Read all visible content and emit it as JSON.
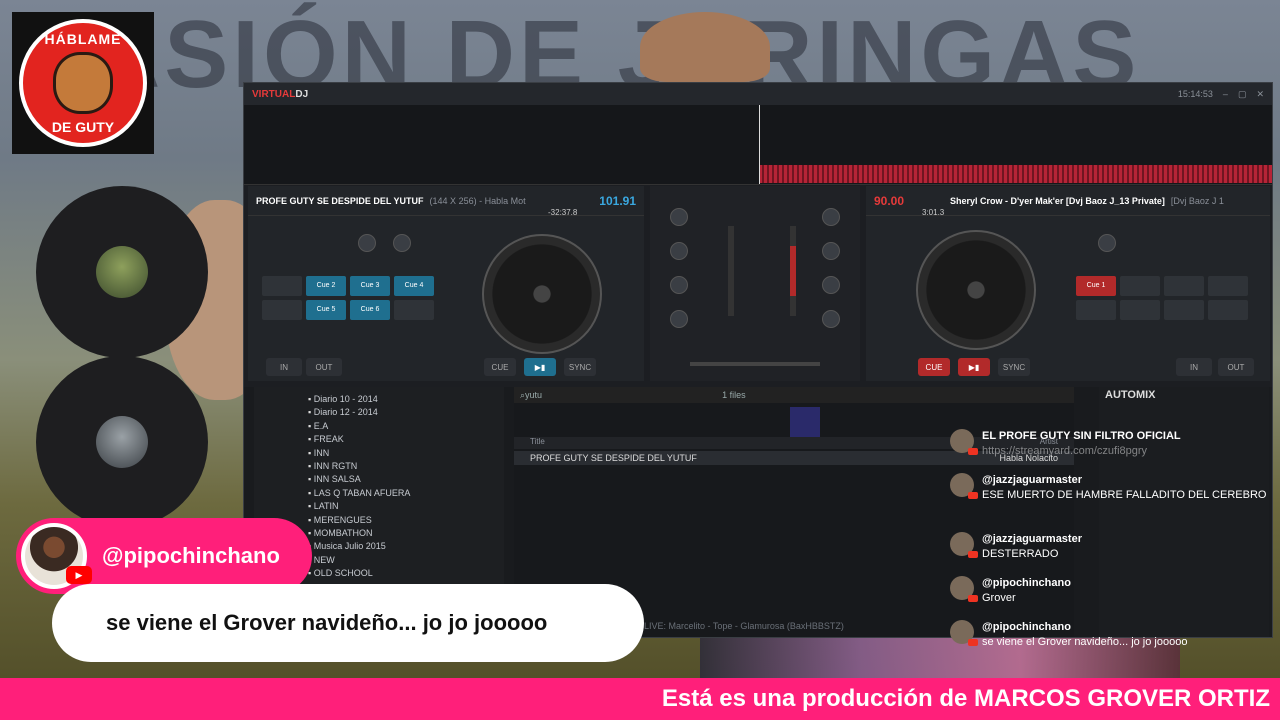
{
  "logo": {
    "top": "HÁBLAME",
    "bottom": "DE GUTY"
  },
  "background": {
    "title_text": "PASIÓN DE JERINGAS"
  },
  "vdj": {
    "app_name_a": "VIRTUAL",
    "app_name_b": "DJ",
    "time": "15:14:53",
    "left_deck": {
      "title": "PROFE GUTY SE DESPIDE DEL YUTUF",
      "meta": "(144 X 256) - Habla Mot",
      "bpm": "101.91",
      "elapsed": "-32:37.8"
    },
    "right_deck": {
      "title": "Sheryl Crow - D'yer Mak'er [Dvj Baoz J_13 Private]",
      "meta": "[Dvj Baoz J 1",
      "bpm": "90.00",
      "elapsed": "3:01.3"
    },
    "left_pads": [
      "Cue 2",
      "Cue 3",
      "Cue 4",
      "Cue 5",
      "Cue 6"
    ],
    "right_pads": [
      "Cue 1"
    ],
    "left_controls": [
      "IN",
      "OUT",
      "CUE",
      "▶▮",
      "SYNC"
    ],
    "right_controls": [
      "CUE",
      "▶▮",
      "SYNC",
      "IN",
      "OUT"
    ],
    "folders": [
      "Diario 10 - 2014",
      "Diario 12 - 2014",
      "E.A",
      "FREAK",
      "INN",
      "INN RGTN",
      "INN SALSA",
      "LAS Q TABAN AFUERA",
      "LATIN",
      "MERENGUES",
      "MOMBATHON",
      "Musica Julio 2015",
      "NEW",
      "OLD SCHOOL"
    ],
    "browser": {
      "search": "yutu",
      "count": "1 files",
      "col_title": "Title",
      "col_artist": "Artist",
      "row_title": "PROFE GUTY SE DESPIDE DEL YUTUF",
      "row_artist": "Habla Nolacito",
      "status": "LIVE: Marcelito - Tope - Glamurosa (BaxHBBSTZ)"
    },
    "automix": {
      "title": "AUTOMIX"
    }
  },
  "chat": [
    {
      "name": "EL PROFE GUTY SIN FILTRO OFICIAL",
      "text": "https://streamyard.com/czufi8pgry",
      "dim": true
    },
    {
      "name": "@jazzjaguarmaster",
      "text": "ESE MUERTO DE HAMBRE FALLADITO DEL CEREBRO"
    },
    {
      "name": "@jazzjaguarmaster",
      "text": "DESTERRADO"
    },
    {
      "name": "@pipochinchano",
      "text": "Grover"
    },
    {
      "name": "@pipochinchano",
      "text": "se viene el Grover navideño... jo jo jooooo"
    }
  ],
  "featured": {
    "name": "@pipochinchano",
    "message": "se viene el Grover navideño... jo jo jooooo"
  },
  "ticker": {
    "text": "Está es una producción de MARCOS GROVER ORTIZ"
  },
  "colors": {
    "accent": "#ff1f7a",
    "deck_blue": "#1f6f8f",
    "deck_red": "#b22a2a"
  }
}
